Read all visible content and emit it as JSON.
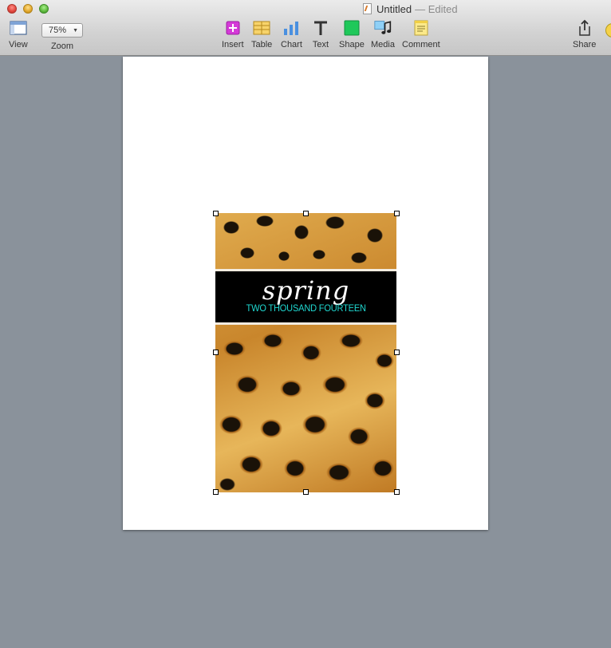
{
  "window": {
    "title": "Untitled",
    "status": "— Edited"
  },
  "toolbar": {
    "view_label": "View",
    "zoom_label": "Zoom",
    "zoom_value": "75%",
    "insert_label": "Insert",
    "table_label": "Table",
    "chart_label": "Chart",
    "text_label": "Text",
    "shape_label": "Shape",
    "media_label": "Media",
    "comment_label": "Comment",
    "share_label": "Share"
  },
  "document": {
    "image": {
      "headline": "spring",
      "subheadline": "TWO THOUSAND FOURTEEN"
    }
  },
  "colors": {
    "accent_text": "#1fd8d1",
    "canvas_bg": "#8a929b",
    "insert_icon": "#d53ad8",
    "shape_icon": "#1fc85a"
  }
}
